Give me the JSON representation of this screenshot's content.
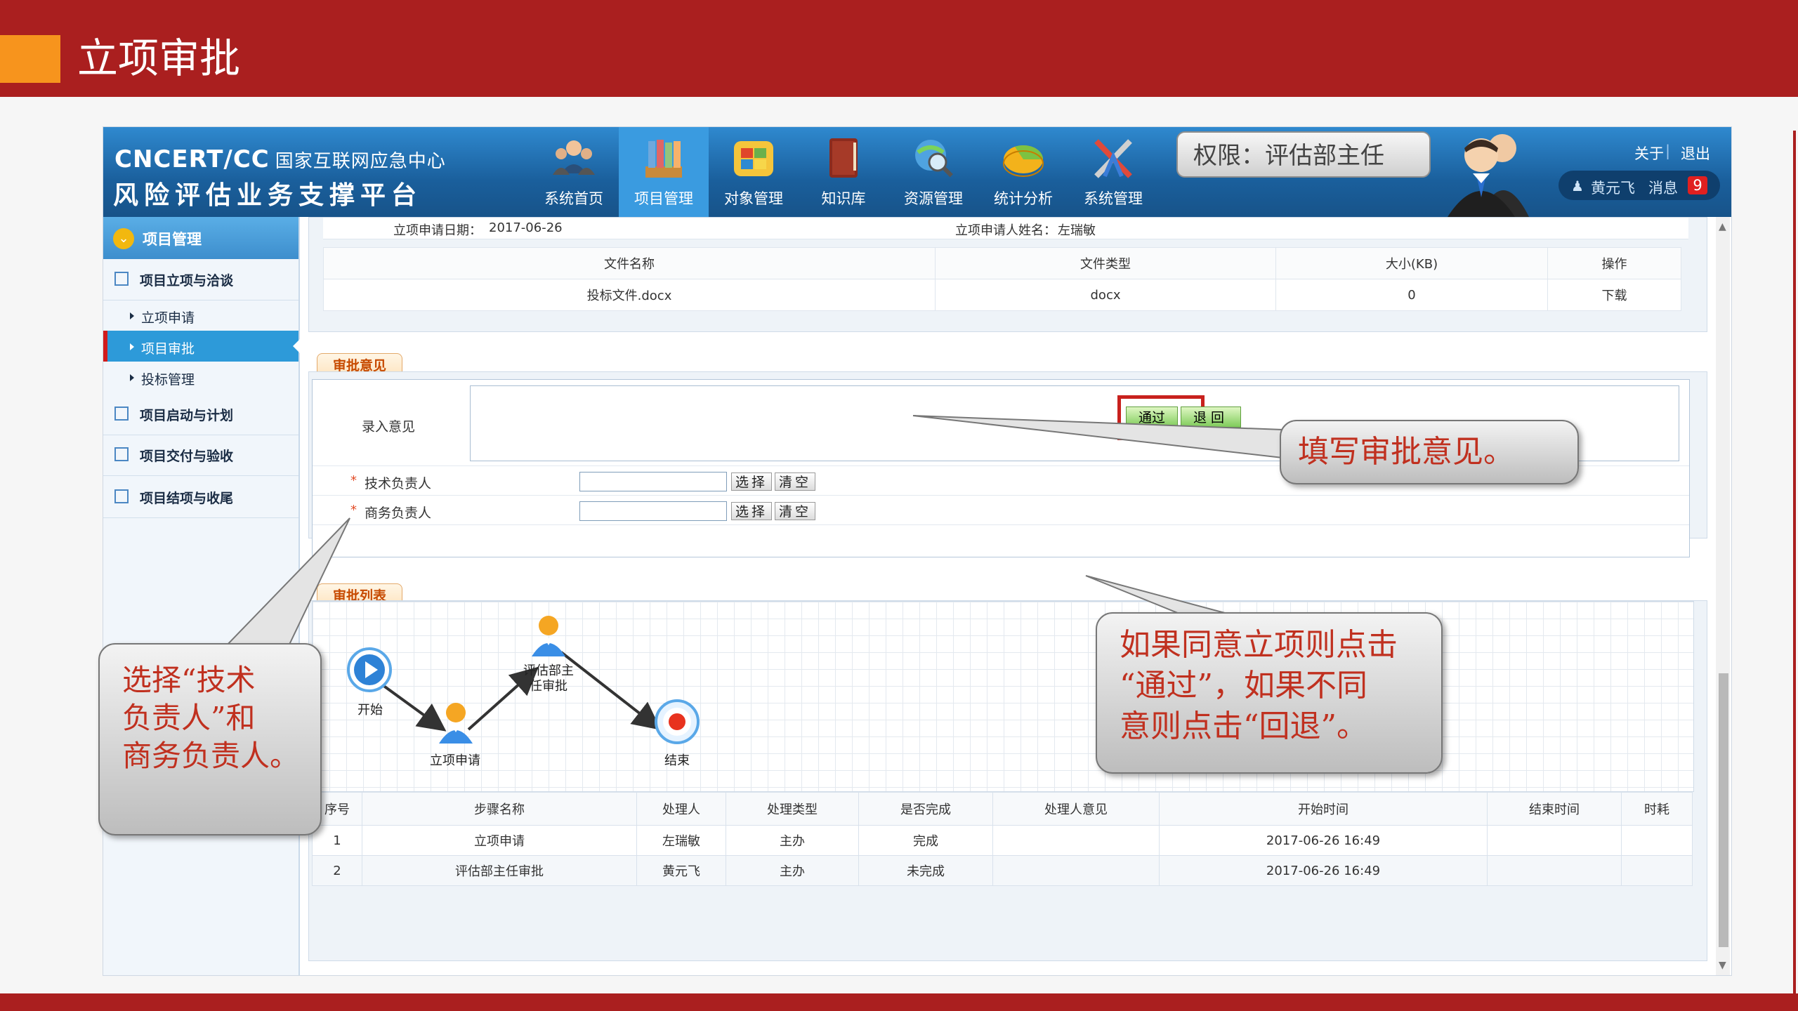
{
  "slide": {
    "title": "立项审批",
    "colors": {
      "topbar": "#aa1f1f",
      "accent_block": "#f7941d"
    }
  },
  "app": {
    "logo_line1_prefix": "CNCERT/CC",
    "logo_line1_sub": "国家互联网应急中心",
    "logo_line2": "风险评估业务支撑平台",
    "nav": [
      {
        "label": "系统首页",
        "icon": "users-group-icon"
      },
      {
        "label": "项目管理",
        "icon": "books-icon",
        "active": true
      },
      {
        "label": "对象管理",
        "icon": "windows-grid-icon"
      },
      {
        "label": "知识库",
        "icon": "book-icon"
      },
      {
        "label": "资源管理",
        "icon": "globe-search-icon"
      },
      {
        "label": "统计分析",
        "icon": "pie-chart-icon"
      },
      {
        "label": "系统管理",
        "icon": "tools-icon"
      }
    ],
    "header": {
      "about": "关于",
      "separator": "|",
      "logout": "退出",
      "user_name": "黄元飞",
      "messages_label": "消息",
      "messages_count": "9"
    }
  },
  "sidebar": {
    "header": "项目管理",
    "groups": [
      {
        "label": "项目立项与洽谈"
      },
      {
        "label": "项目启动与计划"
      },
      {
        "label": "项目交付与验收"
      },
      {
        "label": "项目结项与收尾"
      }
    ],
    "sub_items": [
      {
        "label": "立项申请"
      },
      {
        "label": "项目审批",
        "active": true
      },
      {
        "label": "投标管理"
      }
    ]
  },
  "project_info": {
    "date_label": "立项申请日期：",
    "date_value": "2017-06-26",
    "applicant_label": "立项申请人姓名：",
    "applicant_value": "左瑞敏",
    "file_table": {
      "headers": [
        "文件名称",
        "文件类型",
        "大小(KB)",
        "操作"
      ],
      "rows": [
        [
          "投标文件.docx",
          "docx",
          "0",
          "下载"
        ]
      ]
    }
  },
  "opinion": {
    "tab": "审批意见",
    "input_label": "录入意见",
    "tech_lead_label": "技术负责人",
    "biz_lead_label": "商务负责人",
    "required_mark": "*",
    "select_btn": "选择",
    "clear_btn": "清空",
    "pass_btn": "通过",
    "back_btn": "退回"
  },
  "approval_list": {
    "tab": "审批列表",
    "flow": {
      "start": "开始",
      "step1": "立项申请",
      "step2_line1": "评估部主",
      "step2_line2": "任审批",
      "end": "结束"
    },
    "table": {
      "headers": [
        "序号",
        "步骤名称",
        "处理人",
        "处理类型",
        "是否完成",
        "处理人意见",
        "开始时间",
        "结束时间",
        "时耗"
      ],
      "rows": [
        [
          "1",
          "立项申请",
          "左瑞敏",
          "主办",
          "完成",
          "",
          "2017-06-26 16:49",
          "",
          ""
        ],
        [
          "2",
          "评估部主任审批",
          "黄元飞",
          "主办",
          "未完成",
          "",
          "2017-06-26 16:49",
          "",
          ""
        ]
      ]
    }
  },
  "callouts": {
    "permission": "权限：评估部主任",
    "fill_opinion": "填写审批意见。",
    "if_agree_line1": "如果同意立项则点击",
    "if_agree_line2": "“通过”，如果不同",
    "if_agree_line3": "意则点击“回退”。",
    "select_leads_line1": "选择“技术",
    "select_leads_line2": "负责人”和",
    "select_leads_line3": "商务负责人。"
  }
}
